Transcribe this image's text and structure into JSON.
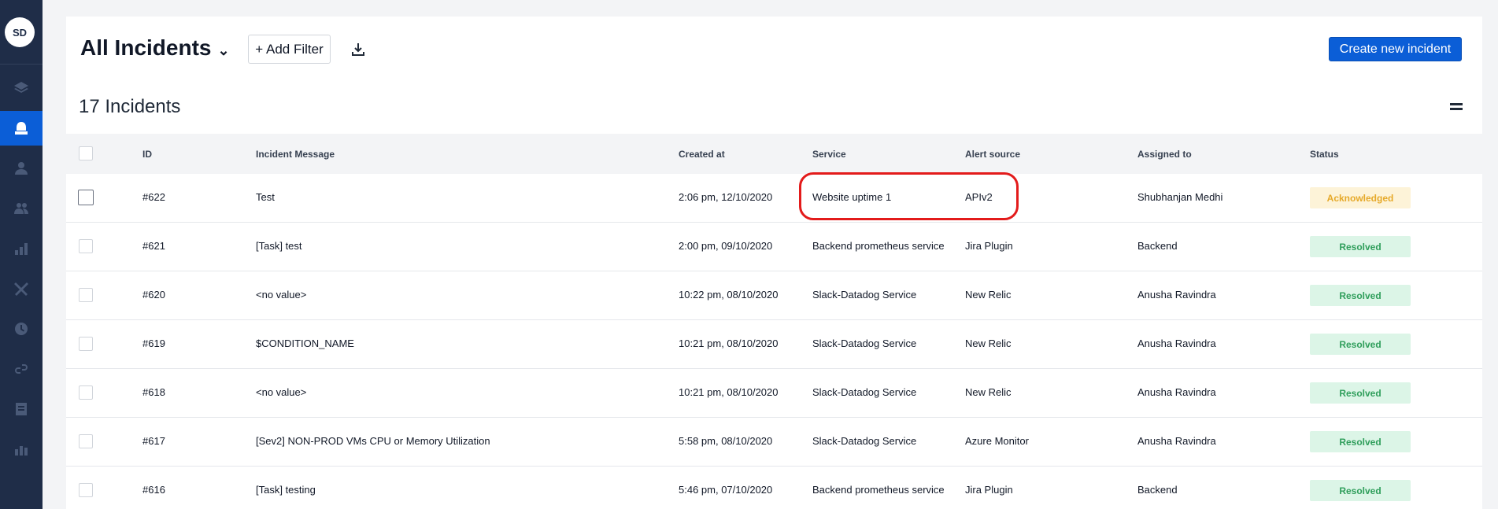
{
  "user": {
    "initials": "SD"
  },
  "header": {
    "title": "All Incidents",
    "add_filter_label": "+ Add Filter",
    "create_button_label": "Create new incident"
  },
  "incidents_count": "17 Incidents",
  "table": {
    "columns": [
      "ID",
      "Incident Message",
      "Created at",
      "Service",
      "Alert source",
      "Assigned to",
      "Status"
    ],
    "rows": [
      {
        "id": "#622",
        "message": "Test",
        "created": "2:06 pm, 12/10/2020",
        "service": "Website uptime 1",
        "source": "APIv2",
        "assigned": "Shubhanjan Medhi",
        "status": "Acknowledged"
      },
      {
        "id": "#621",
        "message": "[Task] test",
        "created": "2:00 pm, 09/10/2020",
        "service": "Backend prometheus service",
        "source": "Jira Plugin",
        "assigned": "Backend",
        "status": "Resolved"
      },
      {
        "id": "#620",
        "message": "<no value>",
        "created": "10:22 pm, 08/10/2020",
        "service": "Slack-Datadog Service",
        "source": "New Relic",
        "assigned": "Anusha Ravindra",
        "status": "Resolved"
      },
      {
        "id": "#619",
        "message": "$CONDITION_NAME",
        "created": "10:21 pm, 08/10/2020",
        "service": "Slack-Datadog Service",
        "source": "New Relic",
        "assigned": "Anusha Ravindra",
        "status": "Resolved"
      },
      {
        "id": "#618",
        "message": "<no value>",
        "created": "10:21 pm, 08/10/2020",
        "service": "Slack-Datadog Service",
        "source": "New Relic",
        "assigned": "Anusha Ravindra",
        "status": "Resolved"
      },
      {
        "id": "#617",
        "message": "[Sev2] NON-PROD VMs CPU or Memory Utilization",
        "created": "5:58 pm, 08/10/2020",
        "service": "Slack-Datadog Service",
        "source": "Azure Monitor",
        "assigned": "Anusha Ravindra",
        "status": "Resolved"
      },
      {
        "id": "#616",
        "message": "[Task] testing",
        "created": "5:46 pm, 07/10/2020",
        "service": "Backend prometheus service",
        "source": "Jira Plugin",
        "assigned": "Backend",
        "status": "Resolved"
      }
    ]
  },
  "colors": {
    "sidebar": "#1f2d48",
    "accent": "#0b5ed7",
    "highlight": "#e31b1b",
    "resolved": "#2f9e5b",
    "acknowledged": "#e6a92a"
  },
  "sidebar_icons": [
    "layers-icon",
    "incidents-icon",
    "user-icon",
    "team-icon",
    "analytics-icon",
    "tools-icon",
    "clock-icon",
    "integrations-icon",
    "checklist-icon",
    "chart-icon"
  ]
}
